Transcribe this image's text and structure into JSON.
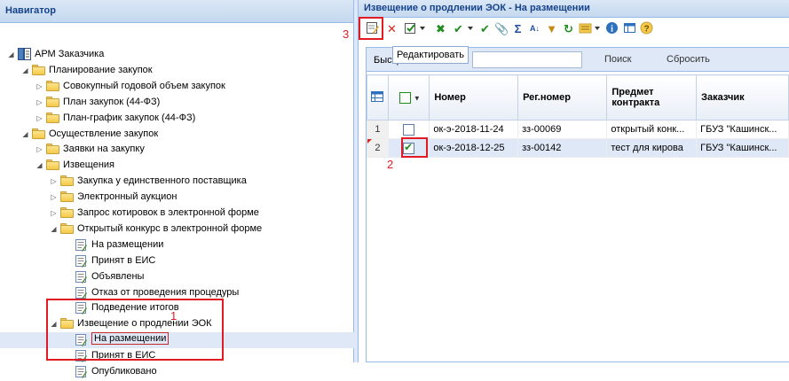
{
  "navigator": {
    "title": "Навигатор",
    "items": [
      {
        "label": "АРМ Заказчика",
        "icon": "app-icon",
        "toggle": "expanded"
      },
      {
        "label": "Планирование закупок",
        "icon": "folder-icon",
        "toggle": "expanded"
      },
      {
        "label": "Совокупный годовой объем закупок",
        "icon": "folder-icon",
        "toggle": "collapsed"
      },
      {
        "label": "План закупок (44-ФЗ)",
        "icon": "folder-icon",
        "toggle": "collapsed"
      },
      {
        "label": "План-график закупок (44-ФЗ)",
        "icon": "folder-icon",
        "toggle": "collapsed"
      },
      {
        "label": "Осуществление закупок",
        "icon": "folder-icon",
        "toggle": "expanded"
      },
      {
        "label": "Заявки на закупку",
        "icon": "folder-icon",
        "toggle": "collapsed"
      },
      {
        "label": "Извещения",
        "icon": "folder-icon",
        "toggle": "expanded"
      },
      {
        "label": "Закупка у единственного поставщика",
        "icon": "folder-icon",
        "toggle": "collapsed"
      },
      {
        "label": "Электронный аукцион",
        "icon": "folder-icon",
        "toggle": "collapsed"
      },
      {
        "label": "Запрос котировок в электронной форме",
        "icon": "folder-icon",
        "toggle": "collapsed"
      },
      {
        "label": "Открытый конкурс в электронной форме",
        "icon": "folder-icon",
        "toggle": "expanded"
      },
      {
        "label": "На размещении",
        "icon": "document-icon"
      },
      {
        "label": "Принят в ЕИС",
        "icon": "document-icon"
      },
      {
        "label": "Объявлены",
        "icon": "document-icon"
      },
      {
        "label": "Отказ от проведения процедуры",
        "icon": "document-icon"
      },
      {
        "label": "Подведение итогов",
        "icon": "document-icon"
      },
      {
        "label": "Извещение о продлении ЭОК",
        "icon": "folder-icon",
        "toggle": "expanded"
      },
      {
        "label": "На размещении",
        "icon": "document-icon"
      },
      {
        "label": "Принят в ЕИС",
        "icon": "document-icon"
      },
      {
        "label": "Опубликовано",
        "icon": "document-icon"
      }
    ]
  },
  "main": {
    "title": "Извещение о продлении ЭОК - На размещении",
    "tooltip": "Редактировать",
    "search": {
      "label": "Быстрый поиск",
      "value": "",
      "search_button": "Поиск",
      "reset_button": "Сбросить"
    },
    "columns": [
      "Номер",
      "Рег.номер",
      "Предмет контракта",
      "Заказчик"
    ],
    "rows": [
      {
        "num": "1",
        "checked": false,
        "number": "ок-э-2018-11-24",
        "reg": "зз-00069",
        "subject": "открытый конк...",
        "customer": "ГБУЗ \"Кашинск..."
      },
      {
        "num": "2",
        "checked": true,
        "number": "ок-э-2018-12-25",
        "reg": "зз-00142",
        "subject": "тест для кирова",
        "customer": "ГБУЗ \"Кашинск..."
      }
    ]
  },
  "annotations": [
    "1",
    "2",
    "3"
  ],
  "colors": {
    "accent_red": "#e01b24",
    "header_blue": "#15428b",
    "selection": "#dfe8f6"
  }
}
